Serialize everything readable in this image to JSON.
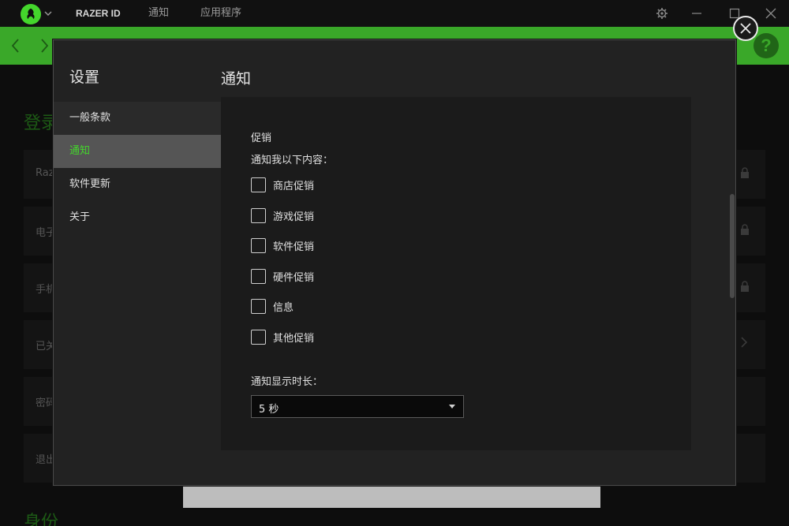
{
  "titlebar": {
    "razer_id": "RAZER ID",
    "notifications": "通知",
    "apps": "应用程序"
  },
  "background": {
    "heading": "登录",
    "heading2": "身份",
    "rows": [
      {
        "label": "Raz",
        "icon": "lock-icon"
      },
      {
        "label": "电子",
        "icon": "lock-icon"
      },
      {
        "label": "手机",
        "icon": "lock-icon"
      },
      {
        "label": "已关",
        "icon": "chevron-right-icon"
      },
      {
        "label": "密码",
        "icon": ""
      },
      {
        "label": "退出",
        "icon": ""
      }
    ]
  },
  "modal": {
    "title": "设置",
    "sidebar": [
      {
        "label": "一般条款",
        "active": false
      },
      {
        "label": "通知",
        "active": true
      },
      {
        "label": "软件更新",
        "active": false
      },
      {
        "label": "关于",
        "active": false
      }
    ],
    "content_title": "通知",
    "section_label": "促销",
    "section_sub": "通知我以下内容：",
    "options": [
      {
        "label": "商店促销",
        "checked": false
      },
      {
        "label": "游戏促销",
        "checked": false
      },
      {
        "label": "软件促销",
        "checked": false
      },
      {
        "label": "硬件促销",
        "checked": false
      },
      {
        "label": "信息",
        "checked": false
      },
      {
        "label": "其他促销",
        "checked": false
      }
    ],
    "duration_label": "通知显示时长：",
    "duration_value": "5 秒"
  },
  "colors": {
    "accent": "#44d62c",
    "header_green": "#3aa829",
    "modal_bg": "#222222"
  }
}
